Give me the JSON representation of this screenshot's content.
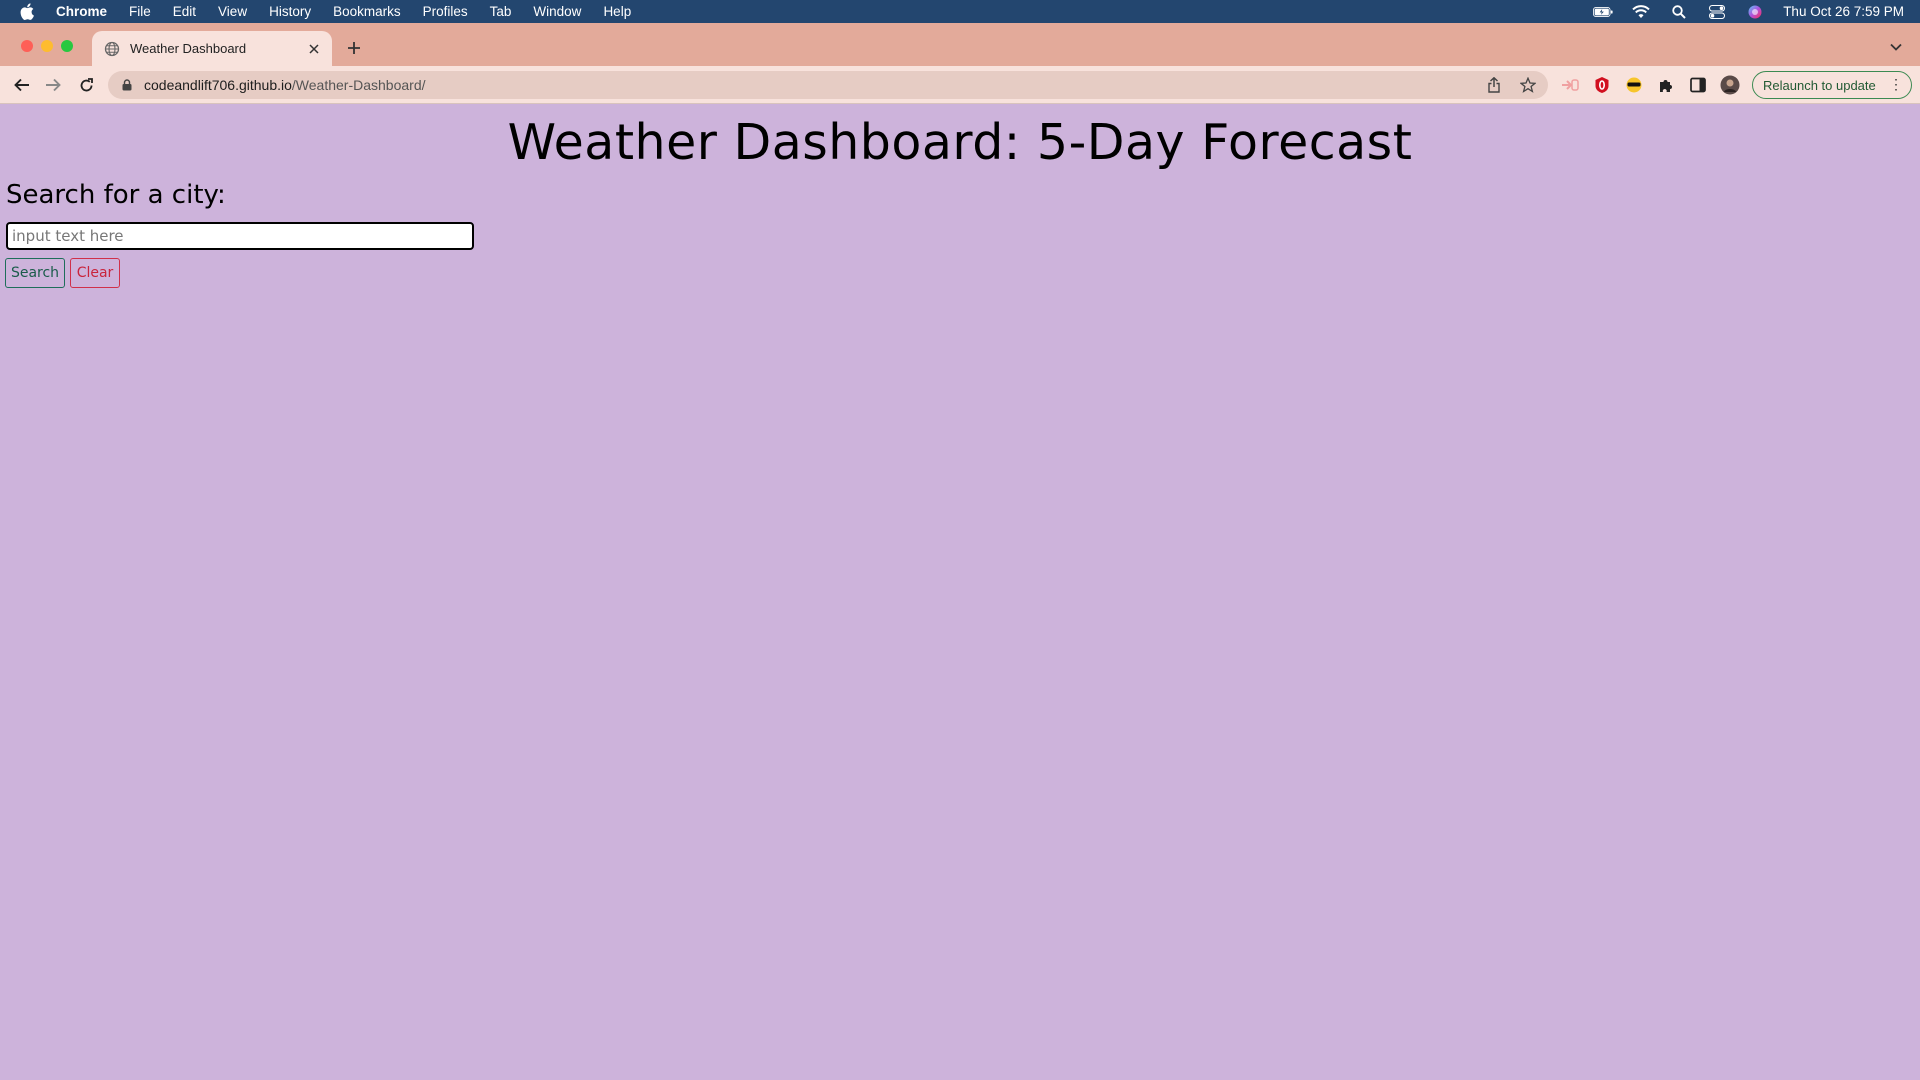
{
  "menubar": {
    "app_name": "Chrome",
    "items": [
      "File",
      "Edit",
      "View",
      "History",
      "Bookmarks",
      "Profiles",
      "Tab",
      "Window",
      "Help"
    ],
    "clock": "Thu Oct 26  7:59 PM",
    "status_icons": [
      "battery-icon",
      "wifi-icon",
      "spotlight-icon",
      "control-center-icon",
      "siri-icon"
    ]
  },
  "tab": {
    "title": "Weather Dashboard"
  },
  "toolbar": {
    "url_host": "codeandlift706.github.io",
    "url_path": "/Weather-Dashboard/",
    "relaunch_label": "Relaunch to update"
  },
  "page": {
    "title": "Weather Dashboard: 5-Day Forecast",
    "search_label": "Search for a city:",
    "input_placeholder": "input text here",
    "input_value": "",
    "search_button": "Search",
    "clear_button": "Clear",
    "background_color": "#cdb3db",
    "search_button_color": "#1a5c4a",
    "clear_button_color": "#c9243c"
  }
}
